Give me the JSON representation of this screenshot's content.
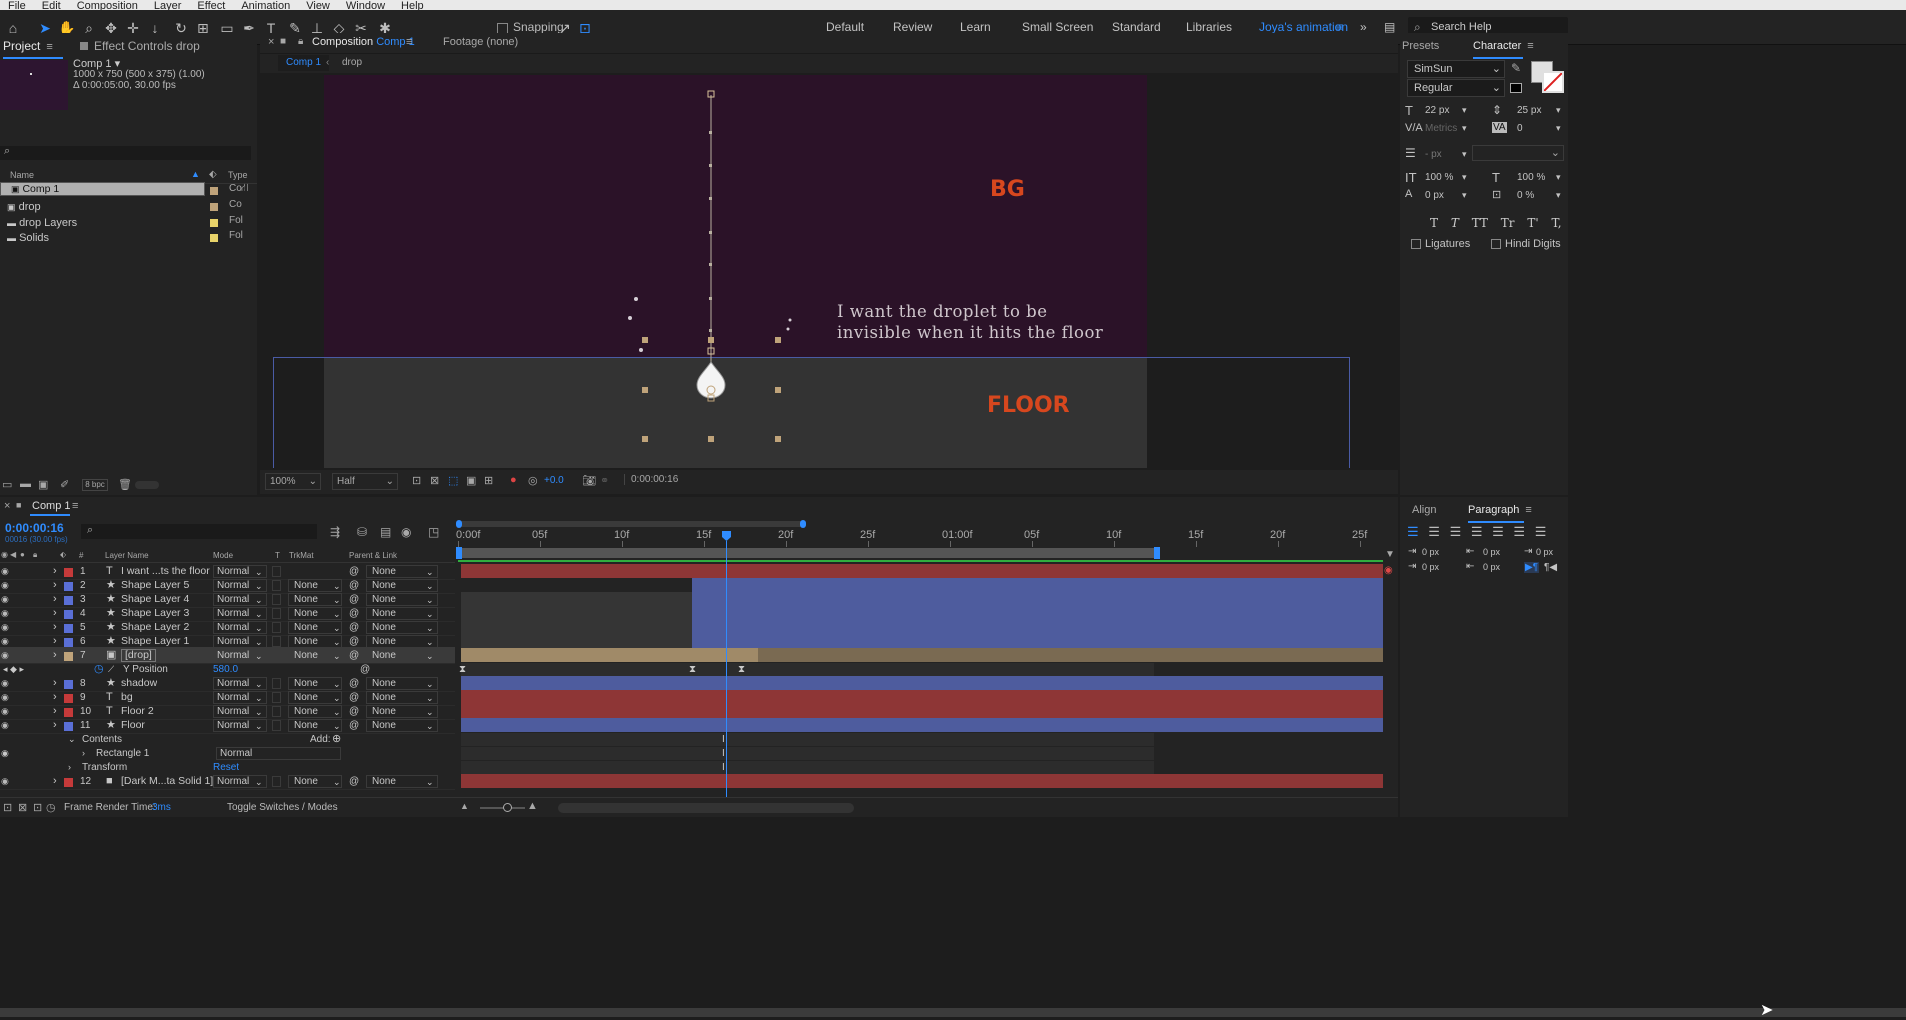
{
  "menubar": [
    "File",
    "Edit",
    "Composition",
    "Layer",
    "Effect",
    "Animation",
    "View",
    "Window",
    "Help"
  ],
  "toolbar": {
    "snapping": "Snapping",
    "search_placeholder": "Search Help"
  },
  "workspaces": [
    "Default",
    "Review",
    "Learn",
    "Small Screen",
    "Standard",
    "Libraries",
    "Joya's animation"
  ],
  "project": {
    "tab_project": "Project",
    "tab_effect": "Effect Controls drop",
    "comp_name": "Comp 1 ▾",
    "comp_info1": "1000 x 750  (500 x 375) (1.00)",
    "comp_info2": "Δ 0:00:05:00, 30.00 fps",
    "col_name": "Name",
    "col_type": "Type",
    "bpc": "8 bpc",
    "items": [
      {
        "name": "Comp 1",
        "type": "Co"
      },
      {
        "name": "drop",
        "type": "Co"
      },
      {
        "name": "drop Layers",
        "type": "Fol"
      },
      {
        "name": "Solids",
        "type": "Fol"
      }
    ]
  },
  "comp": {
    "tab": "Composition",
    "tab_name": "Comp 1",
    "footage": "Footage (none)",
    "crumb1": "Comp 1",
    "crumb2": "drop",
    "bg_label": "BG",
    "floor_label": "FLOOR",
    "note_line1": "I want the droplet to be",
    "note_line2": "invisible when it hits the floor",
    "zoom": "100%",
    "res": "Half",
    "exposure": "+0.0",
    "timecode": "0:00:00:16"
  },
  "timeline": {
    "tab": "Comp 1",
    "timecode": "0:00:00:16",
    "fps": "00016 (30.00 fps)",
    "headers": {
      "layer": "Layer Name",
      "mode": "Mode",
      "t": "T",
      "trk": "TrkMat",
      "parent": "Parent & Link"
    },
    "ruler": [
      "0:00f",
      "05f",
      "10f",
      "15f",
      "20f",
      "25f",
      "01:00f",
      "05f",
      "10f",
      "15f",
      "20f",
      "25f"
    ],
    "layers": [
      {
        "num": "1",
        "type": "T",
        "name": "I want ...ts the floor",
        "mode": "Normal",
        "trk": "",
        "parent": "None",
        "color": "#c53a3a",
        "bar": "#8e3636"
      },
      {
        "num": "2",
        "type": "★",
        "name": "Shape Layer 5",
        "mode": "Normal",
        "trk": "None",
        "parent": "None",
        "color": "#5a6fd6",
        "bar": "#4e5c9e"
      },
      {
        "num": "3",
        "type": "★",
        "name": "Shape Layer 4",
        "mode": "Normal",
        "trk": "None",
        "parent": "None",
        "color": "#5a6fd6",
        "bar": "#4e5c9e"
      },
      {
        "num": "4",
        "type": "★",
        "name": "Shape Layer 3",
        "mode": "Normal",
        "trk": "None",
        "parent": "None",
        "color": "#5a6fd6",
        "bar": "#4e5c9e"
      },
      {
        "num": "5",
        "type": "★",
        "name": "Shape Layer 2",
        "mode": "Normal",
        "trk": "None",
        "parent": "None",
        "color": "#5a6fd6",
        "bar": "#4e5c9e"
      },
      {
        "num": "6",
        "type": "★",
        "name": "Shape Layer 1",
        "mode": "Normal",
        "trk": "None",
        "parent": "None",
        "color": "#5a6fd6",
        "bar": "#4e5c9e"
      },
      {
        "num": "7",
        "type": "▣",
        "name": "[drop]",
        "mode": "Normal",
        "trk": "None",
        "parent": "None",
        "color": "#bfa37a",
        "bar": "#7a6a52"
      }
    ],
    "prop": {
      "name": "Y Position",
      "value": "580.0"
    },
    "layers2": [
      {
        "num": "8",
        "type": "★",
        "name": "shadow",
        "mode": "Normal",
        "trk": "None",
        "parent": "None",
        "color": "#5a6fd6",
        "bar": "#4e5c9e"
      },
      {
        "num": "9",
        "type": "T",
        "name": "bg",
        "mode": "Normal",
        "trk": "None",
        "parent": "None",
        "color": "#c53a3a",
        "bar": "#8e3636"
      },
      {
        "num": "10",
        "type": "T",
        "name": "Floor 2",
        "mode": "Normal",
        "trk": "None",
        "parent": "None",
        "color": "#c53a3a",
        "bar": "#8e3636"
      },
      {
        "num": "11",
        "type": "★",
        "name": "Floor",
        "mode": "Normal",
        "trk": "None",
        "parent": "None",
        "color": "#5a6fd6",
        "bar": "#4e5c9e"
      }
    ],
    "contents": "Contents",
    "add": "Add:",
    "rect": "Rectangle 1",
    "rect_mode": "Normal",
    "transform": "Transform",
    "reset": "Reset",
    "layer12": {
      "num": "12",
      "type": "■",
      "name": "[Dark M...ta Solid 1]",
      "mode": "Normal",
      "trk": "None",
      "parent": "None",
      "color": "#c53a3a",
      "bar": "#8e3636"
    },
    "render": "Frame Render Time:",
    "render_val": "3ms",
    "toggle": "Toggle Switches / Modes"
  },
  "character": {
    "tab_presets": "Presets",
    "tab_char": "Character",
    "font": "SimSun",
    "style": "Regular",
    "size": "22 px",
    "leading": "25 px",
    "kerning": "Metrics",
    "tracking": "0",
    "stroke": "- px",
    "vscale": "100 %",
    "hscale": "100 %",
    "baseline": "0 px",
    "tsume": "0 %",
    "ligatures": "Ligatures",
    "hindi": "Hindi Digits"
  },
  "paragraph": {
    "tab_align": "Align",
    "tab_para": "Paragraph",
    "v1": "0 px",
    "v2": "0 px",
    "v3": "0 px",
    "v4": "0 px",
    "v5": "0 px"
  }
}
